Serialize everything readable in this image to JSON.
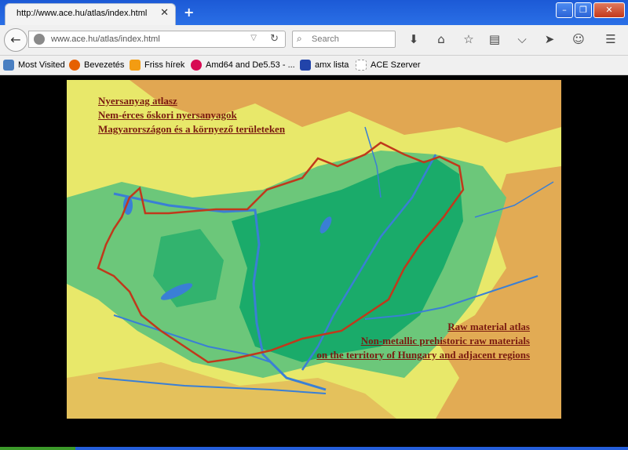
{
  "tab": {
    "title": "http://www.ace.hu/atlas/index.html",
    "close": "✕",
    "new": "+"
  },
  "window": {
    "min": "–",
    "max": "❐",
    "close": "✕"
  },
  "nav": {
    "back": "←",
    "url": "www.ace.hu/atlas/index.html",
    "search_placeholder": "Search",
    "dropdown": "▽",
    "reload": "↻"
  },
  "toolbar_icons": [
    "download-icon",
    "home-icon",
    "star-icon",
    "reading-list-icon",
    "pocket-icon",
    "send-icon",
    "smiley-icon",
    "menu-icon"
  ],
  "bookmarks": [
    {
      "label": "Most Visited",
      "icon": "most-visited-icon",
      "color": "#4a7fc1"
    },
    {
      "label": "Bevezetés",
      "icon": "firefox-icon",
      "color": "#e66000"
    },
    {
      "label": "Friss hírek",
      "icon": "rss-icon",
      "color": "#f39c12"
    },
    {
      "label": "Amd64 and De5.53 - ...",
      "icon": "debian-icon",
      "color": "#d70a53"
    },
    {
      "label": "amx lista",
      "icon": "mailman-icon",
      "color": "#2244aa"
    },
    {
      "label": "ACE Szerver",
      "icon": "page-icon",
      "color": "#999999"
    }
  ],
  "map": {
    "hu_title": "Nyersanyag atlasz",
    "hu_line2": "Nem-érces őskori nyersanyagok",
    "hu_line3": "Magyarországon és a környező területeken",
    "en_title": "Raw material atlas",
    "en_line2": "Non-metallic prehistoric raw materials",
    "en_line3": "on the territory of Hungary and adjacent regions",
    "colors": {
      "lowland": "#1aab6a",
      "midland": "#6cc77a",
      "hills": "#e8e86a",
      "mountains": "#e0a050",
      "border": "#c0391b",
      "water": "#3a7fd5"
    }
  }
}
